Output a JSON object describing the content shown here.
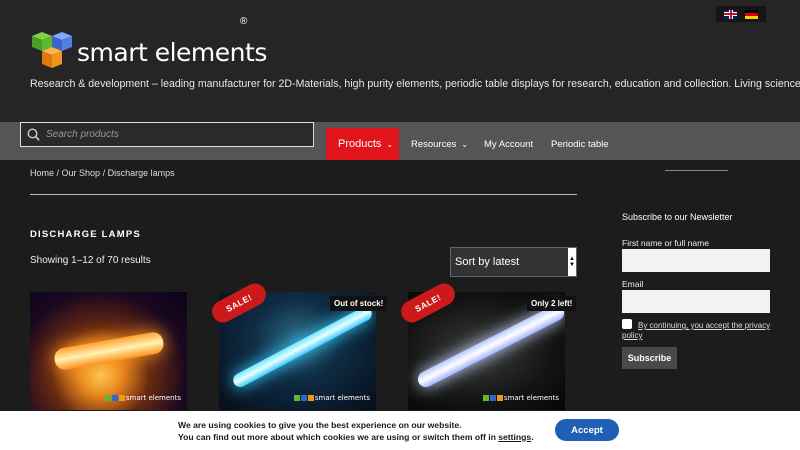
{
  "languages": [
    {
      "code": "en",
      "icon": "uk-flag-icon"
    },
    {
      "code": "de",
      "icon": "german-flag-icon"
    }
  ],
  "site": {
    "logo_text": "smart elements",
    "logo_mark": "®",
    "tagline": "Research & development – leading manufacturer for 2D-Materials, high purity elements, periodic table displays for research, education and collection. Living science…"
  },
  "search": {
    "placeholder": "Search products",
    "icon": "search-icon"
  },
  "nav": {
    "items": [
      {
        "label": "Products",
        "has_dropdown": true,
        "active": true
      },
      {
        "label": "Resources",
        "has_dropdown": true,
        "active": false
      },
      {
        "label": "My Account",
        "has_dropdown": false,
        "active": false
      },
      {
        "label": "Periodic table",
        "has_dropdown": false,
        "active": false
      }
    ],
    "dropdown_icon": "chevron-down-icon",
    "active_color": "#e2141b"
  },
  "breadcrumb": {
    "items": [
      "Home",
      "Our Shop",
      "Discharge lamps"
    ],
    "separator": " / "
  },
  "shop": {
    "title": "DISCHARGE LAMPS",
    "result_count": "Showing 1–12 of 70 results",
    "sort_selected": "Sort by latest"
  },
  "products": [
    {
      "sale_badge": "",
      "stock_badge": "",
      "watermark": "smart elements"
    },
    {
      "sale_badge": "SALE!",
      "stock_badge": "Out of stock!",
      "watermark": "smart elements"
    },
    {
      "sale_badge": "SALE!",
      "stock_badge": "Only 2 left!",
      "watermark": "smart elements"
    }
  ],
  "sale_badge_color": "#cc1a1a",
  "newsletter": {
    "title": "Subscribe to our Newsletter",
    "name_label": "First name or full name",
    "name_value": "",
    "email_label": "Email",
    "email_value": "",
    "consent": "By continuing, you accept the privacy policy",
    "button": "Subscribe"
  },
  "cookie": {
    "line1": "We are using cookies to give you the best experience on our website.",
    "line2_prefix": "You can find out more about which cookies we are using or switch them off in ",
    "line2_link": "settings",
    "line2_suffix": ".",
    "accept": "Accept",
    "accept_color": "#1f5fb5"
  }
}
